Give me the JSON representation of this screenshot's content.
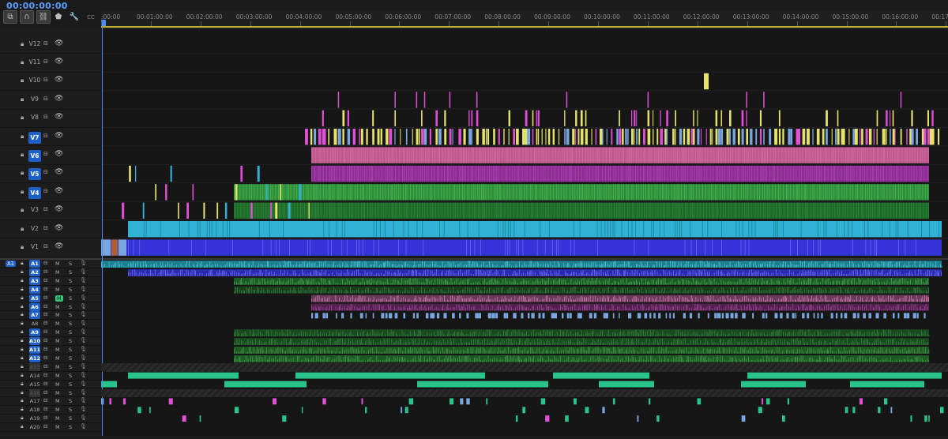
{
  "timecode": "00:00:00:00",
  "toolbar": {
    "icons": [
      "nest-sequence-icon",
      "snap-magnet-icon",
      "linked-selection-icon",
      "add-marker-icon",
      "wrench-settings-icon",
      "captions-icon"
    ],
    "captions_label": "CC"
  },
  "ruler": {
    "labels": [
      ":00:00",
      "00:01:00:00",
      "00:02:00:00",
      "00:03:00:00",
      "00:04:00:00",
      "00:05:00:00",
      "00:06:00:00",
      "00:07:00:00",
      "00:08:00:00",
      "00:09:00:00",
      "00:10:00:00",
      "00:11:00:00",
      "00:12:00:00",
      "00:13:00:00",
      "00:14:00:00",
      "00:15:00:00",
      "00:16:00:00",
      "00:17"
    ]
  },
  "video_tracks": [
    {
      "name": "V12",
      "targeted": false
    },
    {
      "name": "V11",
      "targeted": false
    },
    {
      "name": "V10",
      "targeted": false
    },
    {
      "name": "V9",
      "targeted": false
    },
    {
      "name": "V8",
      "targeted": false
    },
    {
      "name": "V7",
      "targeted": true
    },
    {
      "name": "V6",
      "targeted": true
    },
    {
      "name": "V5",
      "targeted": true
    },
    {
      "name": "V4",
      "targeted": true
    },
    {
      "name": "V3",
      "targeted": false
    },
    {
      "name": "V2",
      "targeted": false
    },
    {
      "name": "V1",
      "targeted": false
    }
  ],
  "audio_source_label": "A1",
  "audio_tracks": [
    {
      "name": "A1",
      "targeted": true,
      "mute": false,
      "disabled": false
    },
    {
      "name": "A2",
      "targeted": true,
      "mute": false,
      "disabled": false
    },
    {
      "name": "A3",
      "targeted": true,
      "mute": false,
      "disabled": false
    },
    {
      "name": "A4",
      "targeted": true,
      "mute": false,
      "disabled": false
    },
    {
      "name": "A5",
      "targeted": true,
      "mute": true,
      "disabled": false
    },
    {
      "name": "A6",
      "targeted": true,
      "mute": false,
      "disabled": false
    },
    {
      "name": "A7",
      "targeted": true,
      "mute": false,
      "disabled": false
    },
    {
      "name": "A8",
      "targeted": false,
      "mute": false,
      "disabled": false
    },
    {
      "name": "A9",
      "targeted": true,
      "mute": false,
      "disabled": false
    },
    {
      "name": "A10",
      "targeted": true,
      "mute": false,
      "disabled": false
    },
    {
      "name": "A11",
      "targeted": true,
      "mute": false,
      "disabled": false
    },
    {
      "name": "A12",
      "targeted": true,
      "mute": false,
      "disabled": false
    },
    {
      "name": "A13",
      "targeted": false,
      "mute": false,
      "disabled": true
    },
    {
      "name": "A14",
      "targeted": false,
      "mute": false,
      "disabled": false
    },
    {
      "name": "A15",
      "targeted": false,
      "mute": false,
      "disabled": false
    },
    {
      "name": "A16",
      "targeted": false,
      "mute": false,
      "disabled": true
    },
    {
      "name": "A17",
      "targeted": false,
      "mute": false,
      "disabled": false
    },
    {
      "name": "A18",
      "targeted": false,
      "mute": false,
      "disabled": false
    },
    {
      "name": "A19",
      "targeted": false,
      "mute": false,
      "disabled": false
    },
    {
      "name": "A20",
      "targeted": false,
      "mute": false,
      "disabled": false
    }
  ],
  "labels": {
    "mute": "M",
    "solo": "S"
  },
  "colors": {
    "playhead": "#4a8fff",
    "yellow": "#e6e36a",
    "magenta": "#e04fd6",
    "pink": "#c05a8e",
    "violet": "#8c2f91",
    "green": "#2f8f3a",
    "darkgreen": "#1f6b2a",
    "cyan": "#2fb2d6",
    "blue": "#3434d8",
    "teal": "#29c48c",
    "lightblue": "#7aa6e0"
  }
}
